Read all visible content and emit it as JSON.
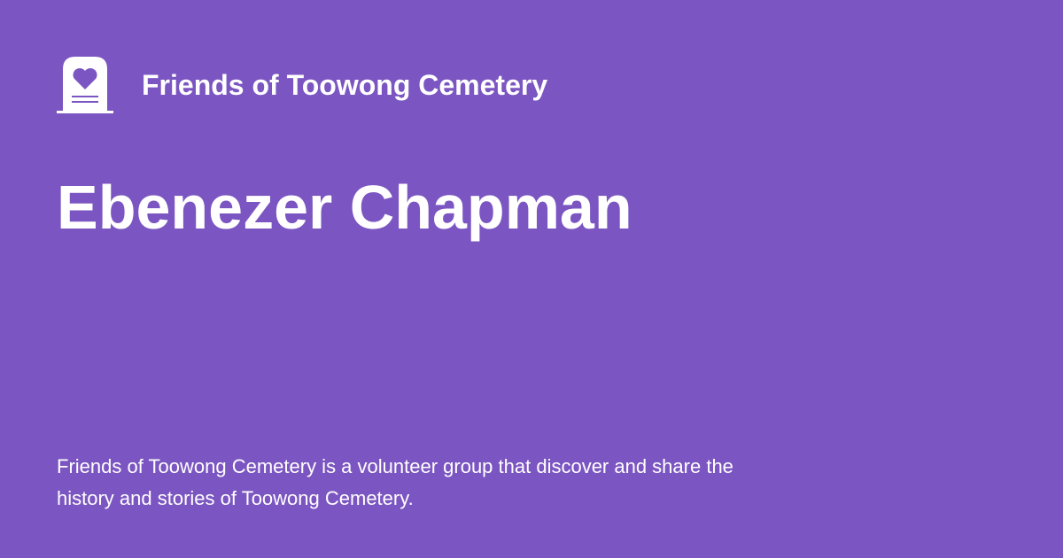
{
  "brand": {
    "icon": "tombstone-heart-icon",
    "name": "Friends of Toowong Cemetery"
  },
  "page": {
    "title": "Ebenezer Chapman",
    "description": "Friends of Toowong Cemetery is a volunteer group that discover and share the history and stories of Toowong Cemetery."
  },
  "colors": {
    "background": "#7b55c1",
    "text": "#ffffff"
  }
}
